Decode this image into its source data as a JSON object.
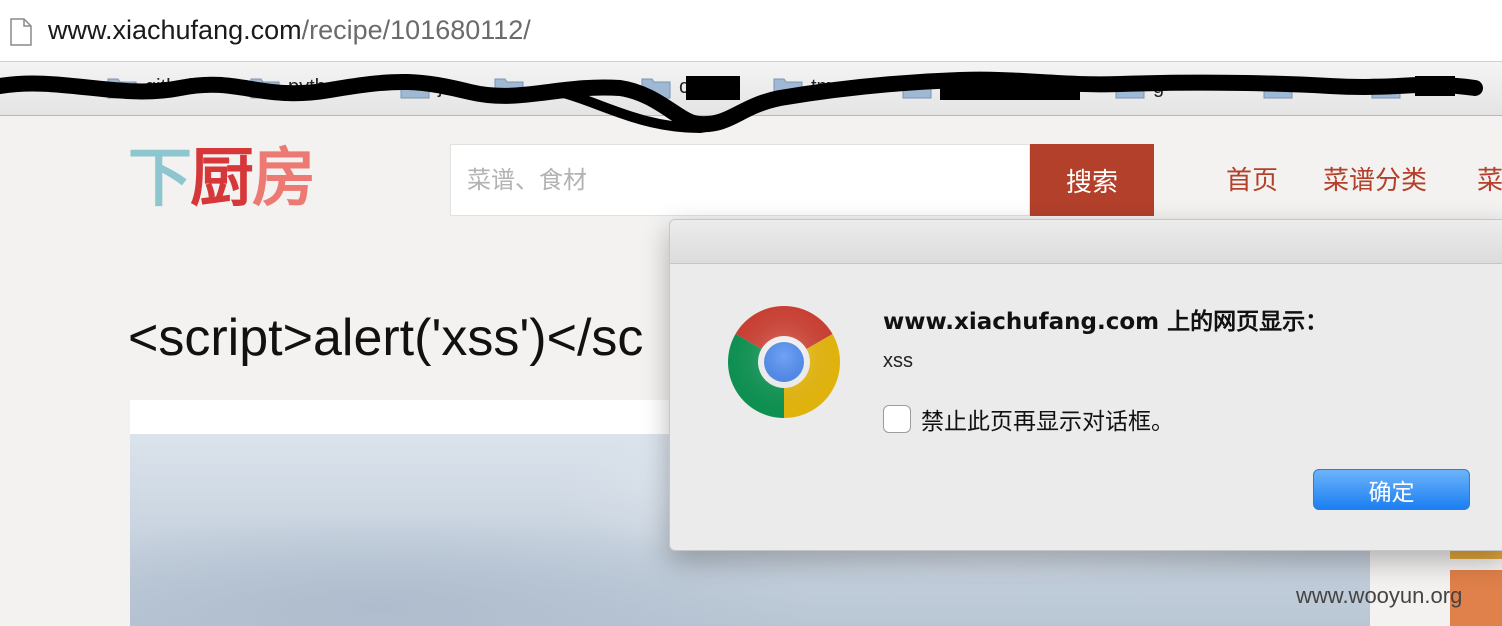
{
  "browser": {
    "url_host": "www.xiachufang.com",
    "url_path": "/recipe/101680112/",
    "page_icon": "page-icon"
  },
  "bookmarks": [
    {
      "label": "github",
      "icon": "folder-icon"
    },
    {
      "label": "python",
      "icon": "folder-icon"
    },
    {
      "label": "j",
      "icon": "folder-icon"
    },
    {
      "label": "urse",
      "icon": "folder-icon"
    },
    {
      "label": "cra",
      "icon": "folder-icon"
    },
    {
      "label": "tmux",
      "icon": "folder-icon"
    },
    {
      "label": "",
      "icon": "folder-icon"
    },
    {
      "label": "g",
      "icon": "folder-icon"
    },
    {
      "label": "",
      "icon": "folder-icon"
    },
    {
      "label": "x",
      "icon": "folder-icon"
    }
  ],
  "site": {
    "logo_parts": [
      "下",
      "厨",
      "房"
    ],
    "search_placeholder": "菜谱、食材",
    "search_button": "搜索",
    "nav": [
      "首页",
      "菜谱分类",
      "菜"
    ],
    "recipe_title": "<script>alert('xss')</sc"
  },
  "dialog": {
    "heading": "www.xiachufang.com 上的网页显示：",
    "message": "xss",
    "suppress_label": "禁止此页再显示对话框。",
    "ok_label": "确定",
    "icon": "chrome-icon"
  },
  "watermark": "www.wooyun.org",
  "colors": {
    "brand_red": "#b3402a",
    "logo_teal": "#8dc6cf",
    "logo_red": "#d6383a",
    "logo_pink": "#ec7a72",
    "ok_blue": "#1b7ff2"
  }
}
